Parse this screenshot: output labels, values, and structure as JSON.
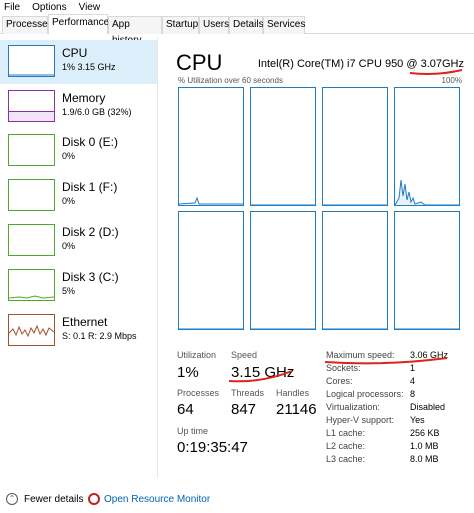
{
  "menu": [
    "File",
    "Options",
    "View"
  ],
  "tabs": [
    "Processes",
    "Performance",
    "App history",
    "Startup",
    "Users",
    "Details",
    "Services"
  ],
  "active_tab": "Performance",
  "sidebar": {
    "items": [
      {
        "name": "CPU",
        "sub": "1% 3.15 GHz",
        "color": "#1f7cc4"
      },
      {
        "name": "Memory",
        "sub": "1.9/6.0 GB (32%)",
        "color": "#8b2ea6"
      },
      {
        "name": "Disk 0 (E:)",
        "sub": "0%",
        "color": "#4ea72e"
      },
      {
        "name": "Disk 1 (F:)",
        "sub": "0%",
        "color": "#4ea72e"
      },
      {
        "name": "Disk 2 (D:)",
        "sub": "0%",
        "color": "#4ea72e"
      },
      {
        "name": "Disk 3 (C:)",
        "sub": "5%",
        "color": "#4ea72e"
      },
      {
        "name": "Ethernet",
        "sub": "S: 0.1 R: 2.9 Mbps",
        "color": "#a0522d"
      }
    ]
  },
  "main": {
    "title": "CPU",
    "model": "Intel(R) Core(TM) i7 CPU 950 @ 3.07GHz",
    "util_label": "% Utilization over 60 seconds",
    "util_max": "100%",
    "stats": {
      "utilization_label": "Utilization",
      "utilization": "1%",
      "speed_label": "Speed",
      "speed": "3.15 GHz",
      "processes_label": "Processes",
      "processes": "64",
      "threads_label": "Threads",
      "threads": "847",
      "handles_label": "Handles",
      "handles": "21146",
      "uptime_label": "Up time",
      "uptime": "0:19:35:47"
    },
    "specs": [
      {
        "k": "Maximum speed:",
        "v": "3.06 GHz"
      },
      {
        "k": "Sockets:",
        "v": "1"
      },
      {
        "k": "Cores:",
        "v": "4"
      },
      {
        "k": "Logical processors:",
        "v": "8"
      },
      {
        "k": "Virtualization:",
        "v": "Disabled"
      },
      {
        "k": "Hyper-V support:",
        "v": "Yes"
      },
      {
        "k": "L1 cache:",
        "v": "256 KB"
      },
      {
        "k": "L2 cache:",
        "v": "1.0 MB"
      },
      {
        "k": "L3 cache:",
        "v": "8.0 MB"
      }
    ]
  },
  "footer": {
    "fewer_details": "Fewer details",
    "open_resource_monitor": "Open Resource Monitor"
  },
  "colors": {
    "cpu_line": "#1f7cc4",
    "annotation": "#e0221b",
    "link": "#0063b1"
  }
}
